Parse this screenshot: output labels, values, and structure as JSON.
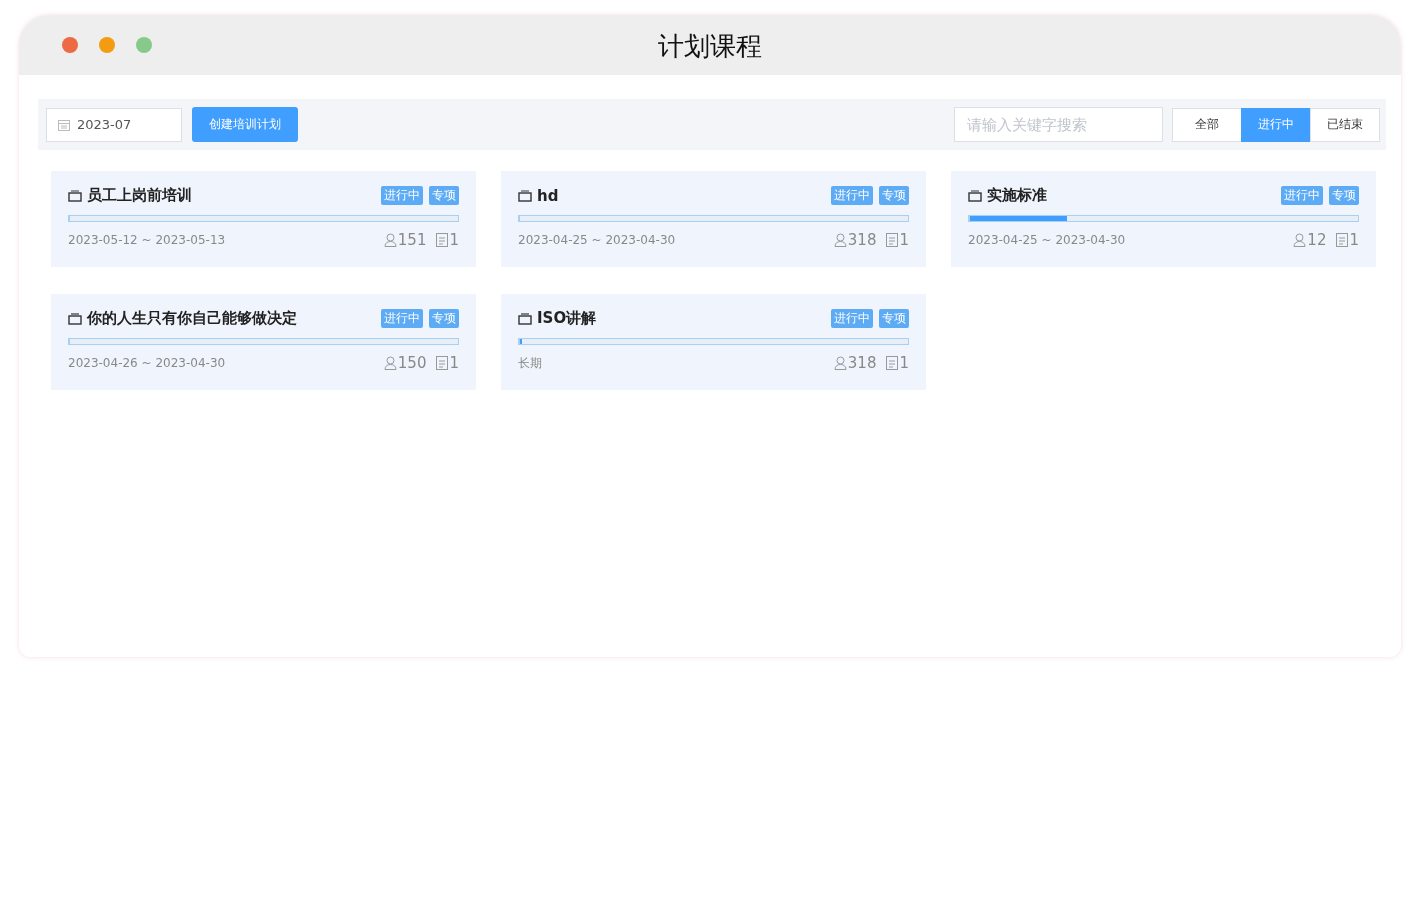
{
  "window": {
    "title": "计划课程"
  },
  "toolbar": {
    "month": "2023-07",
    "create_button": "创建培训计划",
    "search": {
      "placeholder": "请输入关键字搜索"
    },
    "filters": [
      {
        "label": "全部",
        "selected": false
      },
      {
        "label": "进行中",
        "selected": true
      },
      {
        "label": "已结束",
        "selected": false
      }
    ]
  },
  "plans": [
    {
      "title": "员工上岗前培训",
      "tags": [
        "进行中",
        "专项"
      ],
      "level": 0,
      "period": "2023-05-12 ~ 2023-05-13",
      "people": "151",
      "courses": "1"
    },
    {
      "title": "hd",
      "tags": [
        "进行中",
        "专项"
      ],
      "level": 0,
      "period": "2023-04-25 ~ 2023-04-30",
      "people": "318",
      "courses": "1"
    },
    {
      "title": "实施标准",
      "tags": [
        "进行中",
        "专项"
      ],
      "level": 0.25,
      "period": "2023-04-25 ~ 2023-04-30",
      "people": "12",
      "courses": "1"
    },
    {
      "title": "你的人生只有你自己能够做决定",
      "tags": [
        "进行中",
        "专项"
      ],
      "level": 0,
      "period": "2023-04-26 ~ 2023-04-30",
      "people": "150",
      "courses": "1"
    },
    {
      "title": "ISO讲解",
      "tags": [
        "进行中",
        "专项"
      ],
      "level": 0.005,
      "period": "长期",
      "people": "318",
      "courses": "1"
    }
  ]
}
